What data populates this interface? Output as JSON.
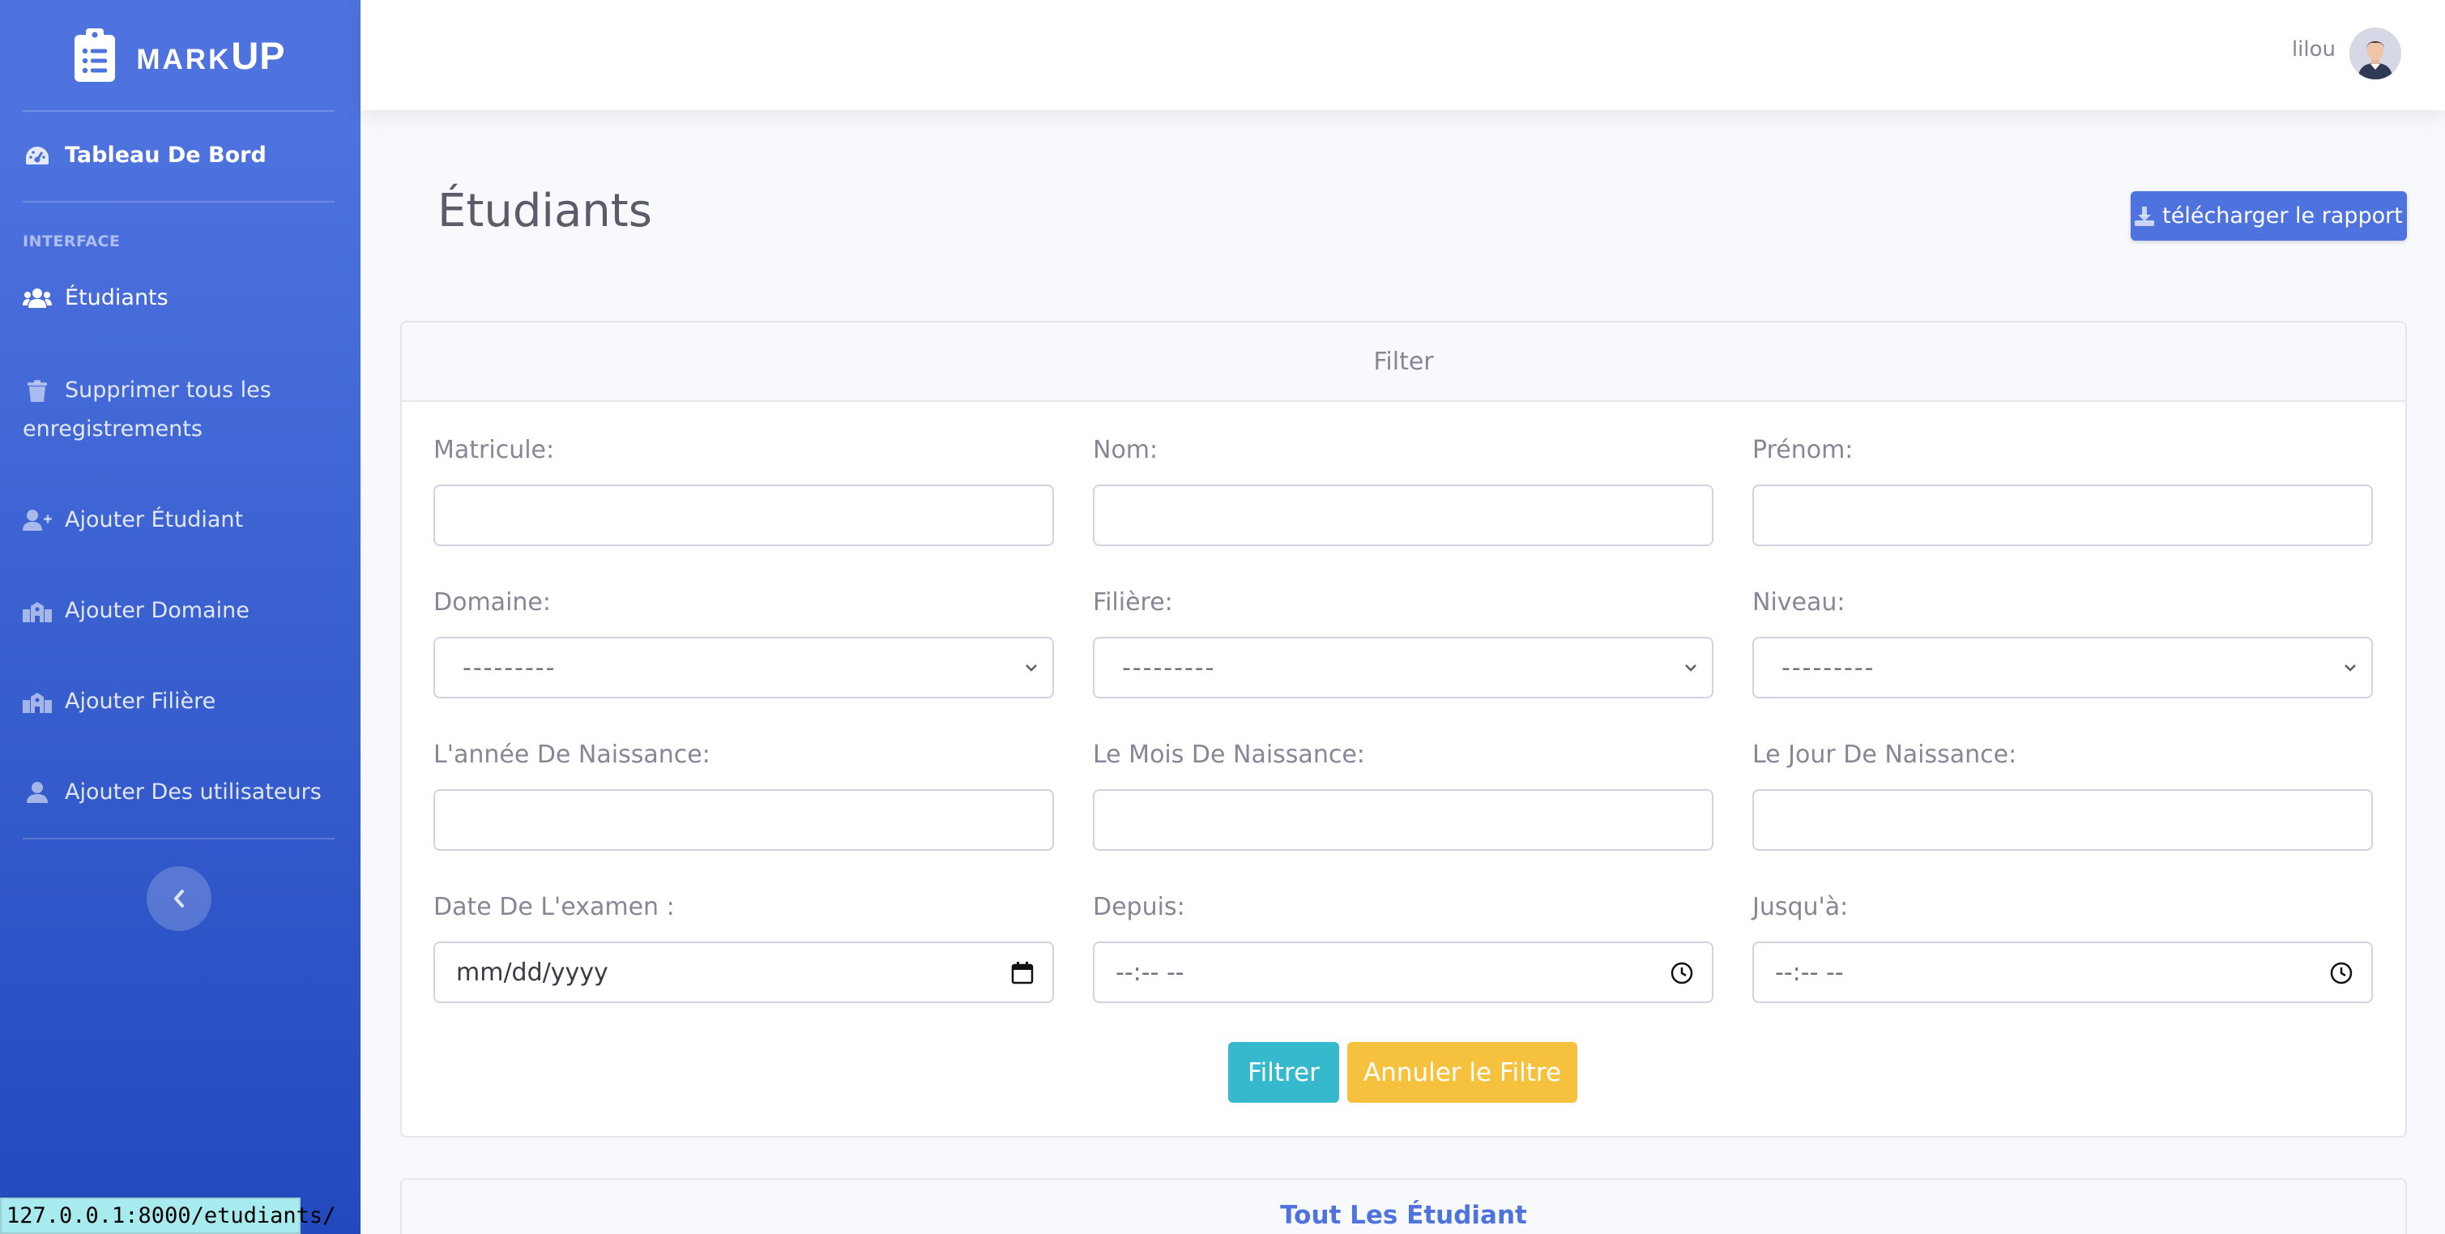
{
  "brand": {
    "text_small": "MARK",
    "text_big": "UP",
    "icon": "clipboard-list-icon"
  },
  "sidebar": {
    "dashboard": {
      "label": "Tableau De Bord",
      "icon": "tachometer-icon"
    },
    "heading": "INTERFACE",
    "items": [
      {
        "label": "Étudiants",
        "icon": "users-icon"
      },
      {
        "label": "Supprimer tous les enregistrements",
        "icon": "trash-icon"
      },
      {
        "label": "Ajouter Étudiant",
        "icon": "user-plus-icon"
      },
      {
        "label": "Ajouter Domaine",
        "icon": "school-icon"
      },
      {
        "label": "Ajouter Filière",
        "icon": "school-icon"
      },
      {
        "label": "Ajouter Des utilisateurs",
        "icon": "user-icon"
      }
    ],
    "toggle_icon": "chevron-left-icon"
  },
  "topbar": {
    "user_name": "lilou"
  },
  "page": {
    "title": "Étudiants",
    "report_button": "télécharger le rapport"
  },
  "filter": {
    "header": "Filter",
    "fields": {
      "matricule": {
        "label": "Matricule:",
        "value": ""
      },
      "nom": {
        "label": "Nom:",
        "value": ""
      },
      "prenom": {
        "label": "Prénom:",
        "value": ""
      },
      "domaine": {
        "label": "Domaine:",
        "selected": "---------"
      },
      "filiere": {
        "label": "Filière:",
        "selected": "---------"
      },
      "niveau": {
        "label": "Niveau:",
        "selected": "---------"
      },
      "annee": {
        "label": "L'année De Naissance:",
        "value": ""
      },
      "mois": {
        "label": "Le Mois De Naissance:",
        "value": ""
      },
      "jour": {
        "label": "Le Jour De Naissance:",
        "value": ""
      },
      "date_examen": {
        "label": "Date De L'examen :",
        "placeholder": "mm/dd/yyyy"
      },
      "depuis": {
        "label": "Depuis:",
        "placeholder": "--:-- --"
      },
      "jusqua": {
        "label": "Jusqu'à:",
        "placeholder": "--:-- --"
      }
    },
    "filter_button": "Filtrer",
    "reset_button": "Annuler le Filtre"
  },
  "students_card": {
    "title": "Tout Les Étudiant"
  },
  "status_bar": {
    "url": "127.0.0.1:8000/etudiants/"
  },
  "colors": {
    "primary": "#4e73df",
    "info": "#36b9cc",
    "warning": "#f6c23e",
    "text": "#858796"
  }
}
